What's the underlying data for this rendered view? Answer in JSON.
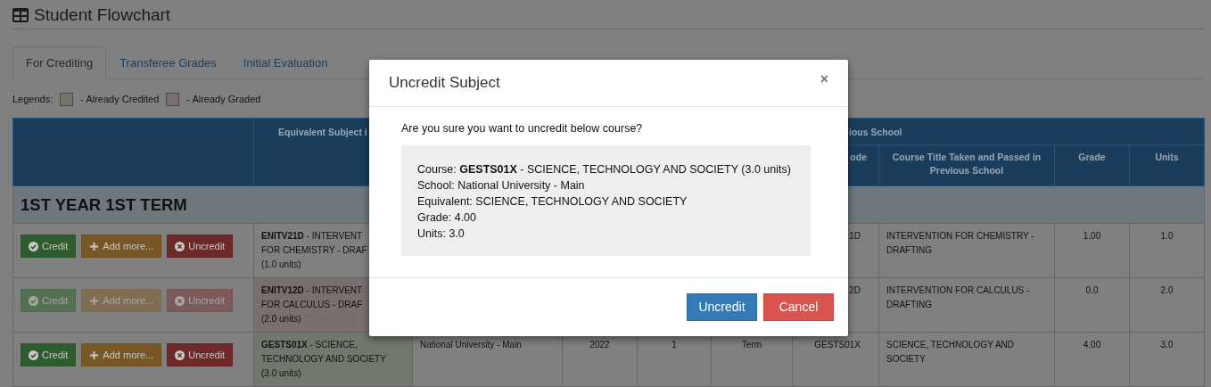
{
  "page": {
    "title": "Student Flowchart"
  },
  "tabs": [
    {
      "label": "For Crediting",
      "selected": true
    },
    {
      "label": "Transferee Grades",
      "selected": false
    },
    {
      "label": "Initial Evaluation",
      "selected": false
    }
  ],
  "legend": {
    "label": "Legends:",
    "items": [
      {
        "kind": "credited",
        "text": "- Already Credited",
        "color": "#70786c"
      },
      {
        "kind": "graded",
        "text": "- Already Graded",
        "color": "#796f6f"
      }
    ]
  },
  "table": {
    "header_top": [
      "Equivalent Subject i",
      "ious School"
    ],
    "columns": [
      "ode",
      "Course Title Taken and Passed in Previous School",
      "Grade",
      "Units"
    ],
    "term_label": "1ST YEAR 1ST TERM",
    "rows": [
      {
        "kind": "plain",
        "disabled": false,
        "buttons": [
          {
            "kind": "credit",
            "label": "Credit"
          },
          {
            "kind": "add",
            "label": "Add more..."
          },
          {
            "kind": "uncredit",
            "label": "Uncredit"
          }
        ],
        "equivalent_lines": [
          "**ENITV21D** - INTERVENT",
          "FOR CHEMISTRY - DRAF",
          "(1.0 units)"
        ],
        "code": "1D",
        "title": "INTERVENTION FOR CHEMISTRY - DRAFTING",
        "grade": "1.00",
        "units": "1.0"
      },
      {
        "kind": "graded",
        "disabled": true,
        "buttons": [
          {
            "kind": "credit",
            "label": "Credit"
          },
          {
            "kind": "add",
            "label": "Add more..."
          },
          {
            "kind": "uncredit",
            "label": "Uncredit"
          }
        ],
        "equivalent_lines": [
          "**ENITV12D** - INTERVENT",
          "FOR CALCULUS - DRAF",
          "(2.0 units)"
        ],
        "code": "2D",
        "title": "INTERVENTION FOR CALCULUS - DRAFTING",
        "grade": "0.0",
        "units": "2.0"
      },
      {
        "kind": "credited",
        "disabled": false,
        "buttons": [
          {
            "kind": "credit",
            "label": "Credit"
          },
          {
            "kind": "add",
            "label": "Add more..."
          },
          {
            "kind": "uncredit",
            "label": "Uncredit"
          }
        ],
        "equivalent_lines": [
          "**GESTS01X** - SCIENCE,",
          "TECHNOLOGY AND SOCIETY",
          "(3.0 units)"
        ],
        "school": "National University - Main",
        "year": "2022",
        "number": "1",
        "period": "Term",
        "code": "GESTS01X",
        "title": "SCIENCE, TECHNOLOGY AND SOCIETY",
        "grade": "4.00",
        "units": "3.0"
      }
    ]
  },
  "dialog": {
    "title": "Uncredit Subject",
    "close": "×",
    "question": "Are you sure you want to uncredit below course?",
    "details": [
      "Course: **GESTS01X** - SCIENCE, TECHNOLOGY AND SOCIETY (3.0 units)",
      "School: National University - Main",
      "Equivalent: SCIENCE, TECHNOLOGY AND SOCIETY",
      "Grade: 4.00",
      "Units: 3.0"
    ],
    "buttons": [
      {
        "kind": "primary",
        "label": "Uncredit"
      },
      {
        "kind": "danger",
        "label": "Cancel"
      }
    ]
  }
}
